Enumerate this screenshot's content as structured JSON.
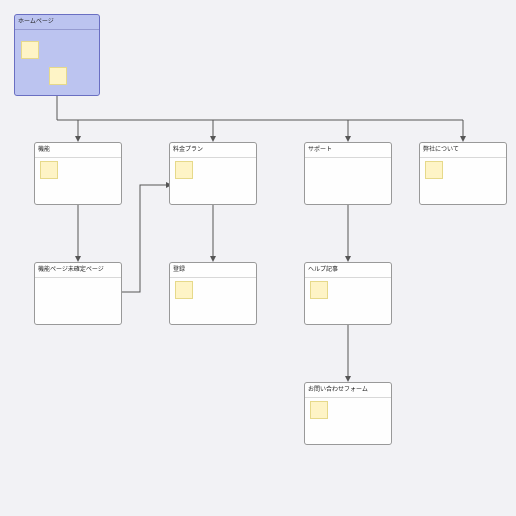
{
  "diagram": {
    "type": "sitemap",
    "nodes": {
      "home": {
        "label": "ホームページ"
      },
      "features": {
        "label": "機能"
      },
      "pricing": {
        "label": "料金プラン"
      },
      "support": {
        "label": "サポート"
      },
      "about": {
        "label": "弊社について"
      },
      "feat_sub1": {
        "label": "機能ページ未確定ページ"
      },
      "register": {
        "label": "登録"
      },
      "help": {
        "label": "ヘルプ記事"
      },
      "contact": {
        "label": "お問い合わせフォーム"
      }
    },
    "edges": [
      [
        "home",
        "features"
      ],
      [
        "home",
        "pricing"
      ],
      [
        "home",
        "support"
      ],
      [
        "home",
        "about"
      ],
      [
        "features",
        "feat_sub1"
      ],
      [
        "pricing",
        "register"
      ],
      [
        "support",
        "help"
      ],
      [
        "help",
        "contact"
      ],
      [
        "feat_sub1",
        "pricing"
      ]
    ]
  }
}
